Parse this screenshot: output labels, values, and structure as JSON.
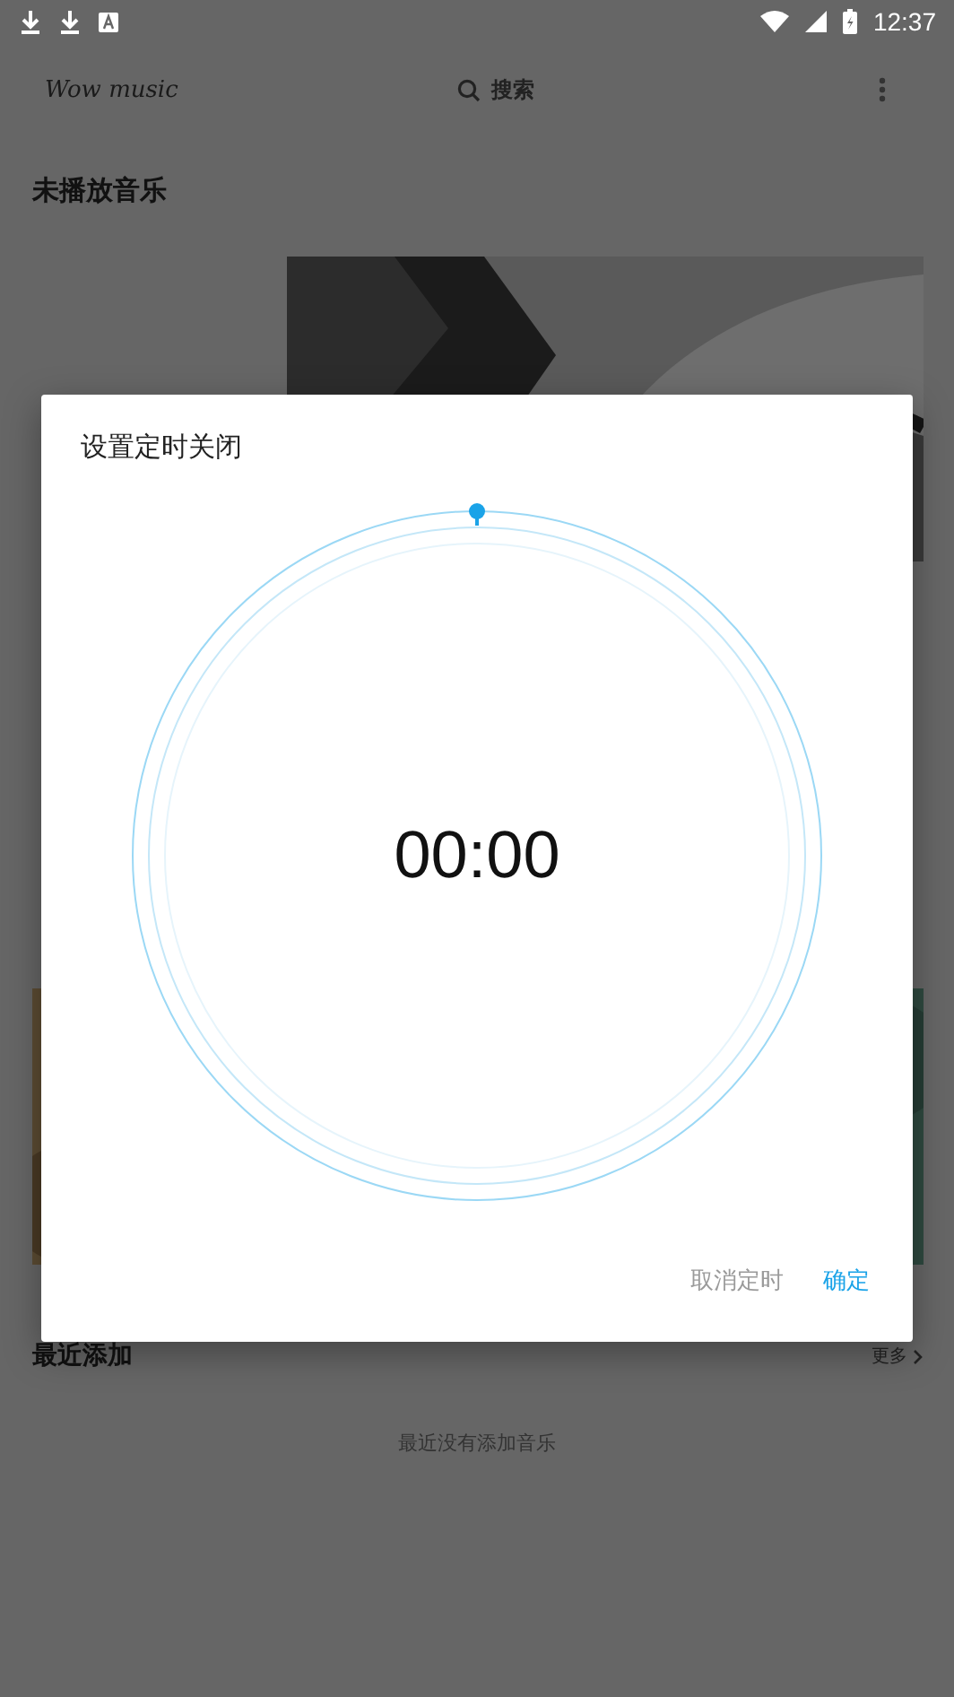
{
  "status_bar": {
    "time": "12:37"
  },
  "app_bar": {
    "logo": "Wow music",
    "search_label": "搜索"
  },
  "sections": [
    {
      "title": "未播放音乐"
    },
    {
      "title": "最近添加",
      "more": "更多",
      "empty_text": "最近没有添加音乐"
    }
  ],
  "dialog": {
    "title": "设置定时关闭",
    "time": "00:00",
    "buttons": [
      {
        "label": "取消定时",
        "disabled": true
      },
      {
        "label": "确定",
        "disabled": false
      }
    ]
  }
}
